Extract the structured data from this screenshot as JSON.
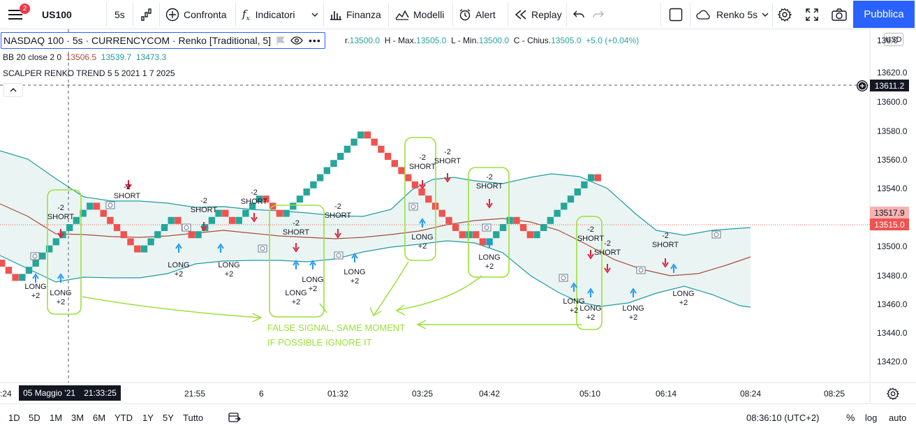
{
  "toolbar": {
    "notifications": "2",
    "symbol": "US100",
    "interval": "5s",
    "compare": "Confronta",
    "indicators": "Indicatori",
    "financials": "Finanza",
    "templates": "Modelli",
    "alert": "Alert",
    "replay": "Replay",
    "chart_type": "Renko 5s",
    "publish": "Pubblica"
  },
  "legend": {
    "symbol": "NASDAQ 100 · 5s · CURRENCYCOM · Renko [Traditional, 5]",
    "ohlc_prefix": "r.",
    "open": "13500.0",
    "high_label": "H - Max.",
    "high": "13505.0",
    "low_label": "L - Min.",
    "low": "13500.0",
    "close_label": "C - Chius.",
    "close": "13505.0",
    "change": "+5.0 (+0.04%)",
    "bb_name": "BB 20 close 2 0",
    "bb_basis": "13506.5",
    "bb_upper": "13539.7",
    "bb_lower": "13473.3",
    "scalper": "SCALPER RENKO TREND 5 5 2021 1 7 2025"
  },
  "price_scale": {
    "currency": "USD",
    "labels": [
      "13640.0",
      "13620.0",
      "13600.0",
      "13580.0",
      "13560.0",
      "13540.0",
      "13500.0",
      "13480.0",
      "13460.0",
      "13440.0",
      "13420.0"
    ],
    "crosshair_price": "13611.2",
    "upper_tag": "13517.9",
    "last_price": "13515.0",
    "partial_top": "136.0"
  },
  "time_axis": {
    "labels": [
      ":24",
      "21:55",
      "6",
      "01:32",
      "03:25",
      "04:42",
      "05:10",
      "06:14",
      "08:24",
      "08:25"
    ],
    "crosshair_date": "05 Maggio '21",
    "crosshair_time": "21:33:25"
  },
  "signals": {
    "short": "SHORT",
    "long": "LONG",
    "minus": "-2",
    "plus": "+2"
  },
  "annotation": {
    "line1": "FALSE SIGNAL, SAME MOMENT",
    "line2": "IF POSSIBLE IGNORE IT"
  },
  "bottom_bar": {
    "ranges": [
      "1D",
      "5D",
      "1M",
      "3M",
      "6M",
      "YTD",
      "1Y",
      "5Y",
      "Tutto"
    ],
    "clock": "08:36:10 (UTC+2)",
    "percent": "%",
    "log": "log",
    "auto": "auto"
  },
  "colors": {
    "bull": "#26a69a",
    "bear": "#ef5350",
    "band_fill": "#e8f4f2",
    "band_line": "#1e9aa0",
    "basis_line": "#a84b3a",
    "arrow_up": "#2196f3",
    "arrow_down": "#e0203a",
    "highlight": "#9be03a",
    "accent": "#2962ff"
  }
}
